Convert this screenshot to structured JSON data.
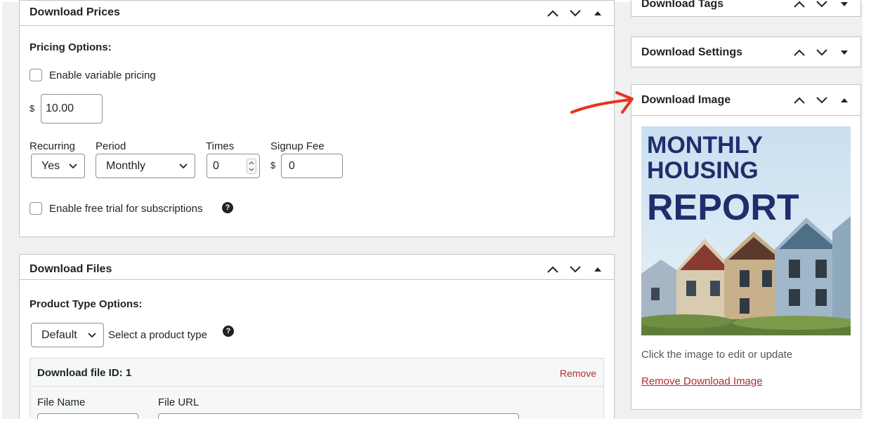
{
  "panels": {
    "download_prices": {
      "title": "Download Prices",
      "pricing_options_label": "Pricing Options:",
      "variable_pricing_label": "Enable variable pricing",
      "currency_symbol": "$",
      "price_value": "10.00",
      "recurring": {
        "label": "Recurring",
        "value": "Yes"
      },
      "period": {
        "label": "Period",
        "value": "Monthly"
      },
      "times": {
        "label": "Times",
        "value": "0"
      },
      "signup_fee": {
        "label": "Signup Fee",
        "currency": "$",
        "value": "0"
      },
      "free_trial_label": "Enable free trial for subscriptions",
      "help_glyph": "?"
    },
    "download_files": {
      "title": "Download Files",
      "product_type_label": "Product Type Options:",
      "product_type_value": "Default",
      "product_type_hint": "Select a product type",
      "help_glyph": "?",
      "file_row": {
        "id_label": "Download file ID: 1",
        "remove_label": "Remove",
        "file_name_label": "File Name",
        "file_url_label": "File URL"
      }
    },
    "download_tags": {
      "title": "Download Tags"
    },
    "download_settings": {
      "title": "Download Settings"
    },
    "download_image": {
      "title": "Download Image",
      "image_text": {
        "line1": "MONTHLY",
        "line2": "HOUSING",
        "line3": "REPORT"
      },
      "caption": "Click the image to edit or update",
      "remove_label": "Remove Download Image"
    }
  },
  "icons": {
    "move_up": "chevron-up-icon",
    "move_down": "chevron-down-icon",
    "toggle_open": "triangle-up-icon",
    "toggle_closed": "triangle-down-icon",
    "annotation": "red-arrow-icon"
  },
  "colors": {
    "link_red": "#b32d2e",
    "annotation_red": "#e8331c",
    "report_text": "#1e2e6d",
    "border": "#c3c4c7"
  }
}
